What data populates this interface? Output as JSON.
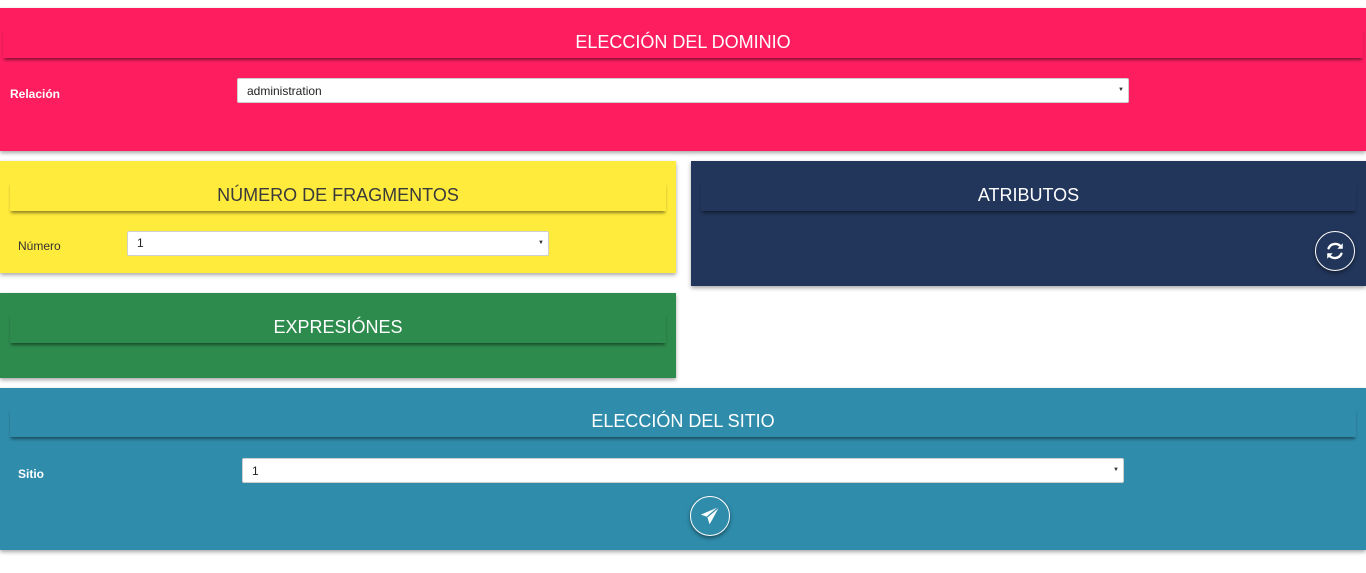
{
  "domain_section": {
    "title": "ELECCIÓN DEL DOMINIO",
    "relation_label": "Relación",
    "relation_value": "administration",
    "color": "#fe1e60"
  },
  "fragments_section": {
    "title": "NÚMERO DE FRAGMENTOS",
    "number_label": "Número",
    "number_value": "1",
    "color": "#ffeb3b"
  },
  "attributes_section": {
    "title": "ATRIBUTOS",
    "refresh_icon": "refresh-icon",
    "color": "#22365b"
  },
  "expressions_section": {
    "title": "EXPRESIÓNES",
    "color": "#2e8b4e"
  },
  "site_section": {
    "title": "ELECCIÓN DEL SITIO",
    "site_label": "Sitio",
    "site_value": "1",
    "send_icon": "send-icon",
    "color": "#2f8cab"
  }
}
